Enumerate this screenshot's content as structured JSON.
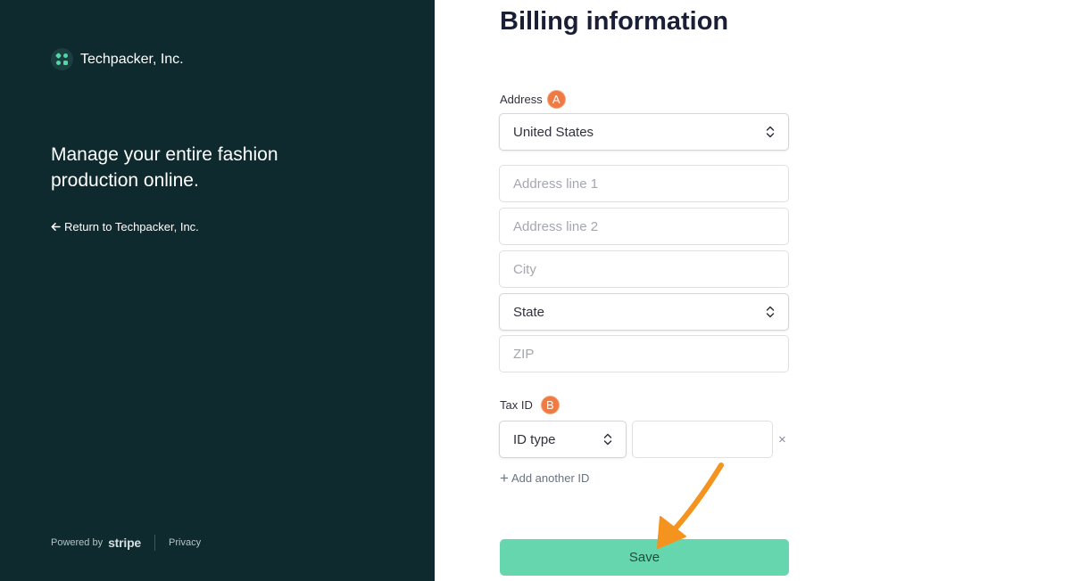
{
  "brand": {
    "name": "Techpacker, Inc."
  },
  "left": {
    "tagline": "Manage your entire fashion production online.",
    "return_link": "Return to Techpacker, Inc.",
    "footer": {
      "powered_by": "Powered by",
      "stripe": "stripe",
      "privacy": "Privacy"
    }
  },
  "form": {
    "title": "Billing information",
    "address_label": "Address",
    "address_badge": "A",
    "country_value": "United States",
    "address_line1_placeholder": "Address line 1",
    "address_line2_placeholder": "Address line 2",
    "city_placeholder": "City",
    "state_value": "State",
    "zip_placeholder": "ZIP",
    "tax_label": "Tax ID",
    "tax_badge": "B",
    "id_type_value": "ID type",
    "tax_id_value": "",
    "close_glyph": "×",
    "add_id_label": "Add another ID",
    "save_label": "Save"
  },
  "colors": {
    "left_bg": "#0e2a2e",
    "badge": "#ee7b43",
    "save_button": "#66d6ae",
    "annotation_arrow": "#f5931f"
  },
  "icons": [
    "techpacker-logo-icon",
    "arrow-left-icon",
    "select-chevrons-icon",
    "close-icon",
    "plus-icon",
    "annotation-arrow-icon"
  ]
}
